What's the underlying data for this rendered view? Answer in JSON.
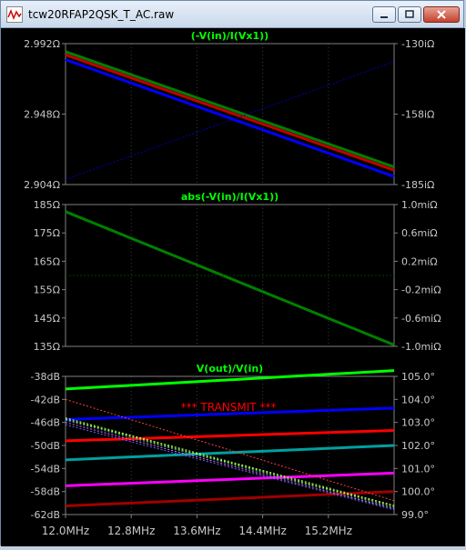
{
  "window": {
    "title": "tcw20RFAP2QSK_T_AC.raw",
    "icon": "waveform-icon",
    "buttons": [
      "minimize",
      "maximize",
      "close"
    ]
  },
  "colors": {
    "background": "#000000",
    "axis": "#808080",
    "grid_dot": "#3a3a3a",
    "title_green": "#00ff00",
    "annotation_red": "#ff0000"
  },
  "plots": [
    {
      "title": "(-V(in)/I(Vx1))",
      "left_ticks": [
        "2.992Ω",
        "2.948Ω",
        "2.904Ω"
      ],
      "right_ticks": [
        "-130iΩ",
        "-158iΩ",
        "-185iΩ"
      ]
    },
    {
      "title": "abs(-V(in)/I(Vx1))",
      "left_ticks": [
        "185Ω",
        "175Ω",
        "165Ω",
        "155Ω",
        "145Ω",
        "135Ω"
      ],
      "right_ticks": [
        "1.0miΩ",
        "0.6miΩ",
        "0.2miΩ",
        "-0.2miΩ",
        "-0.6miΩ",
        "-1.0miΩ"
      ]
    },
    {
      "title": "V(out)/V(in)",
      "annotation": "*** TRANSMIT ***",
      "left_ticks": [
        "-38dB",
        "-42dB",
        "-46dB",
        "-50dB",
        "-54dB",
        "-58dB",
        "-62dB"
      ],
      "right_ticks": [
        "105.0°",
        "104.0°",
        "103.0°",
        "102.0°",
        "101.0°",
        "100.0°",
        "99.0°"
      ]
    }
  ],
  "x_ticks": [
    "12.0MHz",
    "12.8MHz",
    "13.6MHz",
    "14.4MHz",
    "15.2MHz"
  ],
  "chart_data": [
    {
      "type": "line",
      "title": "(-V(in)/I(Vx1))",
      "x_unit": "MHz",
      "xlim": [
        12.0,
        16.0
      ],
      "ylim_left": [
        2.904,
        2.992
      ],
      "ylim_right": [
        -185,
        -130
      ],
      "series": [
        {
          "color": "#008000",
          "axis": "left",
          "x": [
            12.0,
            16.0
          ],
          "y": [
            2.987,
            2.915
          ]
        },
        {
          "color": "#c00000",
          "axis": "left",
          "x": [
            12.0,
            16.0
          ],
          "y": [
            2.985,
            2.913
          ]
        },
        {
          "color": "#0000ff",
          "axis": "left",
          "x": [
            12.0,
            16.0
          ],
          "y": [
            2.982,
            2.909
          ]
        },
        {
          "color": "#0000c0",
          "axis": "right",
          "dashed": true,
          "x": [
            12.0,
            16.0
          ],
          "y": [
            -183,
            -137
          ]
        }
      ]
    },
    {
      "type": "line",
      "title": "abs(-V(in)/I(Vx1))",
      "x_unit": "MHz",
      "xlim": [
        12.0,
        16.0
      ],
      "ylim_left": [
        135,
        185
      ],
      "ylim_right": [
        -1.0,
        1.0
      ],
      "series": [
        {
          "color": "#008000",
          "axis": "left",
          "x": [
            12.0,
            16.0
          ],
          "y": [
            182.5,
            135.5
          ]
        },
        {
          "color": "#004000",
          "axis": "right",
          "dashed": true,
          "x": [
            12.0,
            16.0
          ],
          "y": [
            0.0,
            0.0
          ]
        }
      ]
    },
    {
      "type": "line",
      "title": "V(out)/V(in)",
      "x_unit": "MHz",
      "xlim": [
        12.0,
        16.0
      ],
      "ylim_left": [
        -62,
        -38
      ],
      "ylim_right": [
        99.0,
        105.0
      ],
      "series": [
        {
          "color": "#00ff00",
          "axis": "left",
          "x": [
            12.0,
            16.0
          ],
          "y": [
            -40.2,
            -37.0
          ]
        },
        {
          "color": "#0000ff",
          "axis": "left",
          "x": [
            12.0,
            16.0
          ],
          "y": [
            -45.5,
            -43.5
          ]
        },
        {
          "color": "#ff0000",
          "axis": "left",
          "x": [
            12.0,
            16.0
          ],
          "y": [
            -49.2,
            -47.4
          ]
        },
        {
          "color": "#00a0a0",
          "axis": "left",
          "x": [
            12.0,
            16.0
          ],
          "y": [
            -52.5,
            -50.0
          ]
        },
        {
          "color": "#ff00ff",
          "axis": "left",
          "x": [
            12.0,
            16.0
          ],
          "y": [
            -57.0,
            -54.8
          ]
        },
        {
          "color": "#a00000",
          "axis": "left",
          "x": [
            12.0,
            16.0
          ],
          "y": [
            -60.5,
            -58.0
          ]
        },
        {
          "color": "#ff4040",
          "axis": "right",
          "dashed": true,
          "x": [
            12.0,
            16.0
          ],
          "y": [
            104.0,
            99.6
          ]
        },
        {
          "color": "#80ff80",
          "axis": "right",
          "dashed": true,
          "x": [
            12.0,
            16.0
          ],
          "y": [
            103.2,
            99.4
          ]
        },
        {
          "color": "#ffff00",
          "axis": "right",
          "dashed": true,
          "x": [
            12.0,
            16.0
          ],
          "y": [
            103.15,
            99.35
          ]
        },
        {
          "color": "#00c0c0",
          "axis": "right",
          "dashed": true,
          "x": [
            12.0,
            16.0
          ],
          "y": [
            103.1,
            99.3
          ]
        },
        {
          "color": "#ff60ff",
          "axis": "right",
          "dashed": true,
          "x": [
            12.0,
            16.0
          ],
          "y": [
            103.0,
            99.25
          ]
        },
        {
          "color": "#6060ff",
          "axis": "right",
          "dashed": true,
          "x": [
            12.0,
            16.0
          ],
          "y": [
            102.9,
            99.2
          ]
        }
      ]
    }
  ]
}
